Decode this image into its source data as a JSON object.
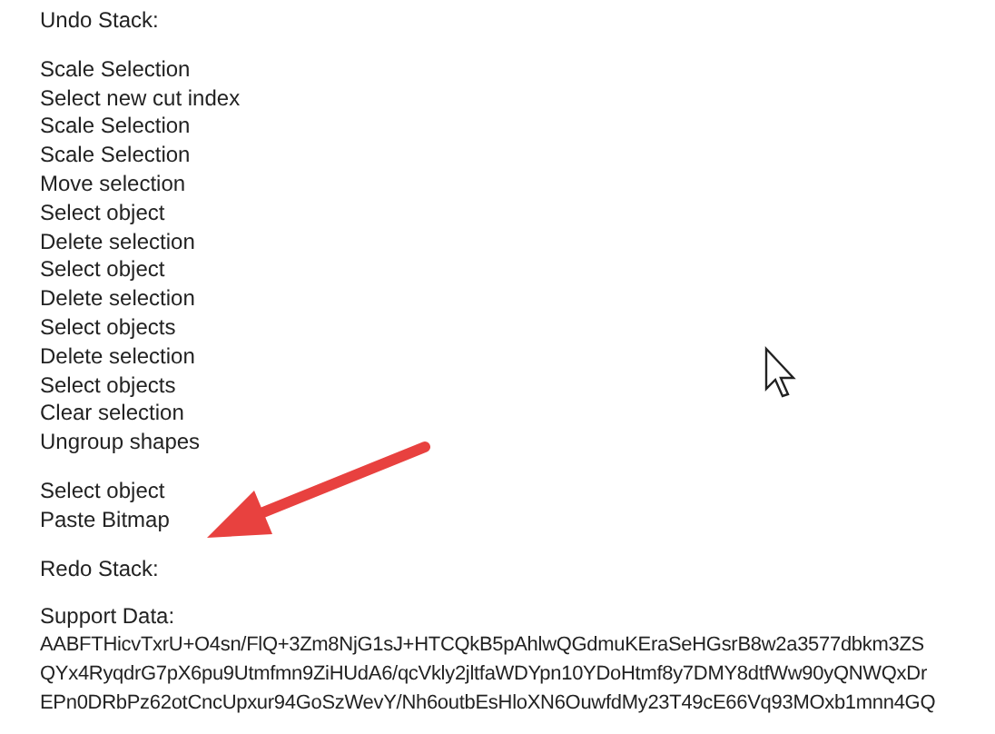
{
  "undo_stack": {
    "title": "Undo Stack:",
    "groups": [
      [
        "Scale Selection",
        "Select new cut index",
        "Scale Selection",
        "Scale Selection",
        "Move selection",
        "Select object",
        "Delete selection",
        "Select object",
        "Delete selection",
        "Select objects",
        "Delete selection",
        "Select objects",
        "Clear selection",
        "Ungroup shapes"
      ],
      [
        "Select object",
        "Paste Bitmap"
      ]
    ]
  },
  "redo_stack": {
    "title": "Redo Stack:"
  },
  "support_data": {
    "title": "Support Data:",
    "lines": [
      "AABFTHicvTxrU+O4sn/FlQ+3Zm8NjG1sJ+HTCQkB5pAhlwQGdmuKEraSeHGsrB8w2a3577dbkm3ZS",
      "QYx4RyqdrG7pX6pu9Utmfmn9ZiHUdA6/qcVkly2jltfaWDYpn10YDoHtmf8y7DMY8dtfWw90yQNWQxDr",
      "EPn0DRbPz62otCncUpxur94GoSzWevY/Nh6outbEsHloXN6OuwfdMy23T49cE66Vq93MOxb1mnn4GQ"
    ]
  }
}
